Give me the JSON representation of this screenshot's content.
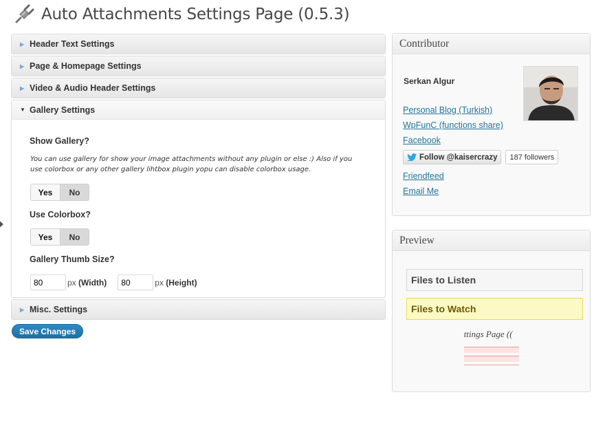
{
  "header": {
    "title": "Auto Attachments Settings Page (0.5.3)",
    "icon": "plugin-icon"
  },
  "sections": {
    "header_text": "Header Text Settings",
    "page_homepage": "Page & Homepage Settings",
    "video_audio": "Video & Audio Header Settings",
    "gallery": "Gallery Settings",
    "misc": "Misc. Settings"
  },
  "gallery": {
    "show_gallery_label": "Show Gallery?",
    "description": "You can use gallery for show your image attachments without any plugin or else :) Also if you use colorbox or any other gallery lihtbox plugin yopu can disable colorbox usage.",
    "show_gallery_yes": "Yes",
    "show_gallery_no": "No",
    "use_colorbox_label": "Use Colorbox?",
    "colorbox_yes": "Yes",
    "colorbox_no": "No",
    "thumb_size_label": "Gallery Thumb Size?",
    "width_value": "80",
    "width_unit": "px",
    "width_label": "(Width)",
    "height_value": "80",
    "height_unit": "px",
    "height_label": "(Height)"
  },
  "save_label": "Save Changes",
  "contributor": {
    "title": "Contributor",
    "name": "Serkan Algur",
    "links": {
      "blog": "Personal Blog (Turkish)",
      "wpfunc": "WpFunC (functions share)",
      "facebook": "Facebook",
      "friendfeed": "Friendfeed",
      "email": "Email Me"
    },
    "follow_label": "Follow @kaisercrazy",
    "followers": "187 followers"
  },
  "preview": {
    "title": "Preview",
    "listen": "Files to Listen",
    "watch": "Files to Watch",
    "thumb_text": "ettings Page (("
  },
  "colors": {
    "accent": "#21759b",
    "button": "#2a84bb",
    "watch_bg": "#fdf9c5"
  }
}
